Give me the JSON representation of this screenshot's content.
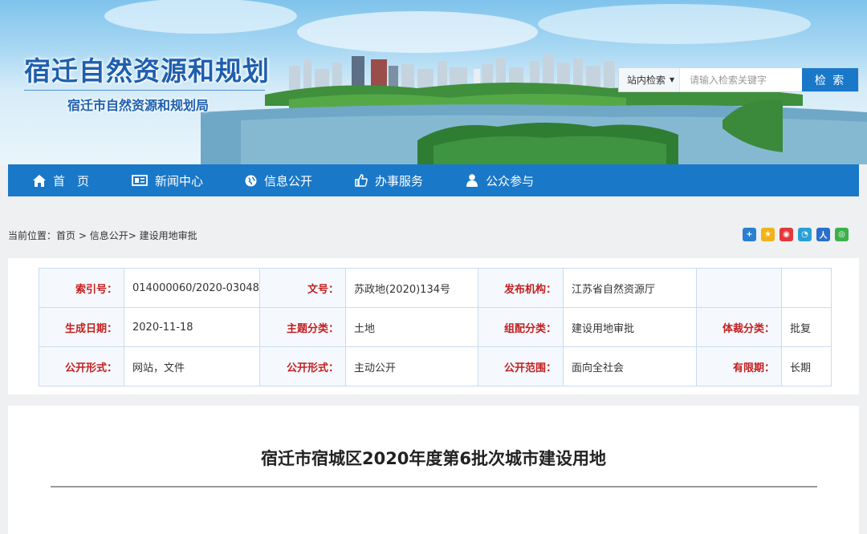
{
  "header": {
    "site_title": "宿迁自然资源和规划",
    "site_subtitle": "宿迁市自然资源和规划局"
  },
  "search": {
    "scope_label": "站内检索",
    "placeholder": "请输入检索关键字",
    "button_label": "检 索"
  },
  "nav": {
    "items": [
      {
        "label": "首　页",
        "icon": "home-icon"
      },
      {
        "label": "新闻中心",
        "icon": "news-icon"
      },
      {
        "label": "信息公开",
        "icon": "globe-icon"
      },
      {
        "label": "办事服务",
        "icon": "thumbs-up-icon"
      },
      {
        "label": "公众参与",
        "icon": "user-icon"
      }
    ]
  },
  "breadcrumb": {
    "prefix": "当前位置：",
    "items": [
      "首页",
      "信息公开",
      "建设用地审批"
    ],
    "separator": " > "
  },
  "share": {
    "icons": [
      "plus-share-icon",
      "qzone-icon",
      "weibo-icon",
      "tencent-weibo-icon",
      "renren-icon",
      "wechat-icon"
    ],
    "colors": [
      "#2a7fcf",
      "#f2b21c",
      "#e4393c",
      "#2a9fd6",
      "#2a6fc9",
      "#3db04a"
    ]
  },
  "meta": {
    "rows": [
      [
        {
          "key": "索引号：",
          "value": "014000060/2020-03048"
        },
        {
          "key": "文号：",
          "value": "苏政地(2020)134号"
        },
        {
          "key": "发布机构：",
          "value": "江苏省自然资源厅"
        },
        {
          "key": "",
          "value": ""
        }
      ],
      [
        {
          "key": "生成日期：",
          "value": "2020-11-18"
        },
        {
          "key": "主题分类：",
          "value": "土地"
        },
        {
          "key": "组配分类：",
          "value": "建设用地审批"
        },
        {
          "key": "体裁分类：",
          "value": "批复"
        }
      ],
      [
        {
          "key": "公开形式：",
          "value": "网站，文件"
        },
        {
          "key": "公开形式：",
          "value": "主动公开"
        },
        {
          "key": "公开范围：",
          "value": "面向全社会"
        },
        {
          "key": "有限期：",
          "value": "长期"
        }
      ]
    ]
  },
  "article": {
    "title": "宿迁市宿城区2020年度第6批次城市建设用地"
  },
  "colors": {
    "primary_blue": "#1a78c8",
    "title_blue": "#1e5fae",
    "key_red": "#c41e1e",
    "border": "#c9dcef"
  }
}
